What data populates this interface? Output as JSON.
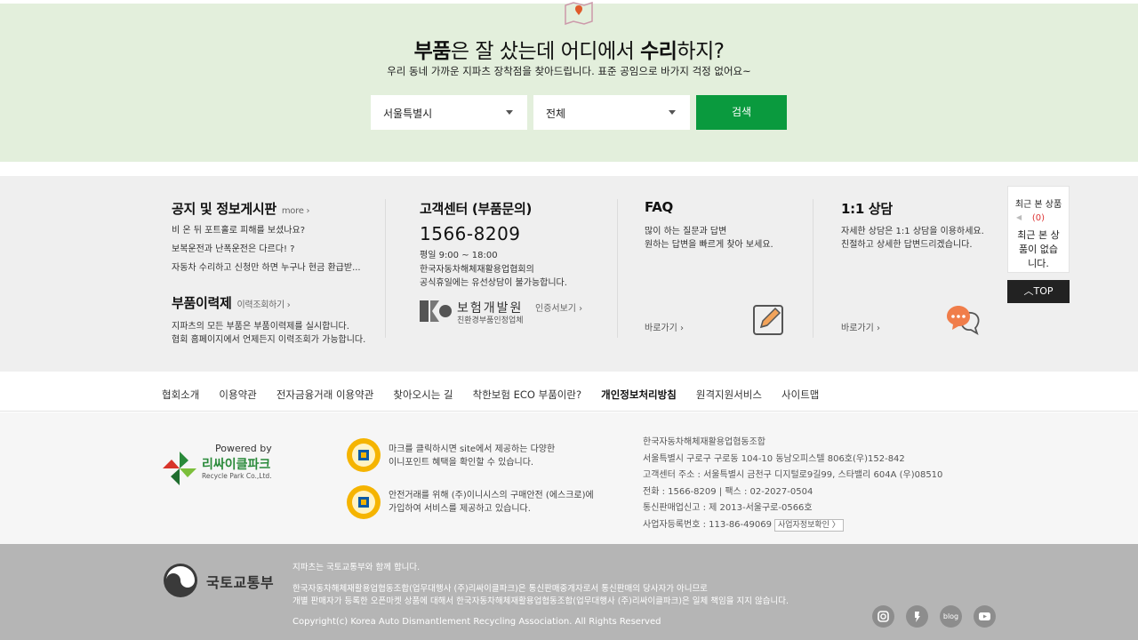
{
  "hero": {
    "title_part1": "부품",
    "title_part2": "은 잘 샀는데 어디에서 ",
    "title_part3": "수리",
    "title_part4": "하지?",
    "subtitle": "우리 동네 가까운 지파츠 장착점을 찾아드립니다. 표준 공임으로 바가지 걱정 없어요~",
    "region_select": "서울특별시",
    "type_select": "전체",
    "search_label": "검색"
  },
  "notice": {
    "title": "공지 및 정보게시판",
    "more": "more ›",
    "items": [
      "비 온 뒤 포트홀로 피해를 보셨나요?",
      "보복운전과 난폭운전은 다르다! ?",
      "자동차 수리하고 신청만 하면 누구나 현금 환급받..."
    ],
    "history_title": "부품이력제",
    "history_link": "이력조회하기 ›",
    "history_desc1": "지파츠의 모든 부품은 부품이력제를 실시합니다.",
    "history_desc2": "협회 홈페이지에서 언제든지 이력조회가 가능합니다."
  },
  "cs": {
    "title": "고객센터 (부품문의)",
    "phone": "1566-8209",
    "hours": "평일 9:00 ~ 18:00",
    "desc1": "한국자동차해체재활용업협회의",
    "desc2": "공식휴일에는 유선상담이 불가능합니다.",
    "kidi_name": "보험개발원",
    "kidi_sub": "친환경부품인정업체",
    "kidi_link": "인증서보기 ›"
  },
  "faq": {
    "title": "FAQ",
    "desc1": "많이 하는 질문과 답변",
    "desc2": "원하는 답변을 빠르게 찾아 보세요.",
    "go": "바로가기 ›"
  },
  "qa": {
    "title": "1:1 상담",
    "desc1": "자세한 상담은 1:1 상담을 이용하세요.",
    "desc2": "친절하고 상세한 답변드리겠습니다.",
    "go": "바로가기 ›"
  },
  "recent": {
    "title": "최근 본 상품",
    "count": "(0)",
    "empty": "최근 본 상품이 없습니다."
  },
  "top_label": "TOP",
  "footer_nav": [
    "협회소개",
    "이용약관",
    "전자금융거래 이용약관",
    "찾아오시는 길",
    "착한보험 ECO 부품이란?",
    "개인정보처리방침",
    "원격지원서비스",
    "사이트맵"
  ],
  "recyclepark": {
    "powered": "Powered by",
    "name": "리싸이클파크",
    "en": "Recycle Park Co.,Ltd."
  },
  "badges": {
    "text1a": "마크를 클릭하시면 site에서 제공하는 다양한",
    "text1b": "이니포인트 혜택을 확인할 수 있습니다.",
    "text2a": "안전거래를 위해 (주)이니시스의 구매안전 (에스크로)에",
    "text2b": "가입하여 서비스를 제공하고 있습니다."
  },
  "corp": {
    "name": "한국자동차해체재활용업협동조합",
    "addr": "서울특별시 구로구 구로동 104-10 동남오피스텔 806호(우)152-842",
    "cs_addr": "고객센터 주소 : 서울특별시 금천구 디지털로9길99, 스타밸리 604A (우)08510",
    "tel": "전화 : 1566-8209 | 팩스 : 02-2027-0504",
    "mail_order": "통신판매업신고 : 제 2013-서울구로-0566호",
    "biz_no": "사업자등록번호 : 113-86-49069",
    "biz_btn": "사업자정보확인 〉"
  },
  "bottom": {
    "molit": "국토교통부",
    "line1": "지파츠는 국토교통부와 함께 합니다.",
    "line2a": "한국자동차해체재활용업협동조합(업무대행사 (주)리싸이클파크)은 통신판매중개자로서 통신판매의 당사자가 아니므로",
    "line2b": "개별 판매자가 등록한 오픈마켓 상품에 대해서 한국자동차해체재활용업협동조합(업무대행사 (주)리싸이클파크)은 일체 책임을 지지 않습니다.",
    "copyright": "Copyright(c) Korea Auto Dismantlement Recycling Association. All Rights Reserved",
    "sns_blog": "blog"
  },
  "colors": {
    "accent": "#0a9a3e",
    "hero_bg": "#e3efdc",
    "info_bg": "#efefef",
    "footer_bg": "#b5b5b5"
  }
}
